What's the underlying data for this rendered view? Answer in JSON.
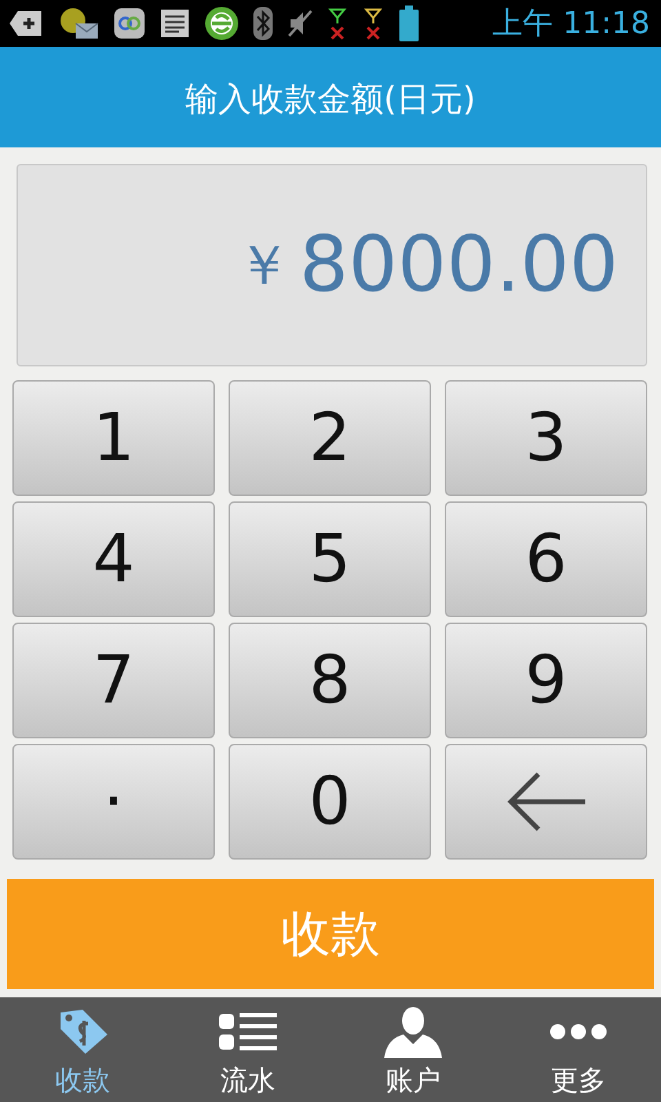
{
  "status_bar": {
    "time": "上午 11:18"
  },
  "header": {
    "title": "输入收款金额(日元)"
  },
  "amount": {
    "currency": "￥",
    "value": "8000.00"
  },
  "keypad": [
    {
      "kind": "digit",
      "label": "1"
    },
    {
      "kind": "digit",
      "label": "2"
    },
    {
      "kind": "digit",
      "label": "3"
    },
    {
      "kind": "digit",
      "label": "4"
    },
    {
      "kind": "digit",
      "label": "5"
    },
    {
      "kind": "digit",
      "label": "6"
    },
    {
      "kind": "digit",
      "label": "7"
    },
    {
      "kind": "digit",
      "label": "8"
    },
    {
      "kind": "digit",
      "label": "9"
    },
    {
      "kind": "dot",
      "label": "·"
    },
    {
      "kind": "digit",
      "label": "0"
    },
    {
      "kind": "backspace"
    }
  ],
  "submit": {
    "label": "收款"
  },
  "nav": [
    {
      "label": "收款",
      "selected": true
    },
    {
      "label": "流水",
      "selected": false
    },
    {
      "label": "账户",
      "selected": false
    },
    {
      "label": "更多",
      "selected": false
    }
  ]
}
